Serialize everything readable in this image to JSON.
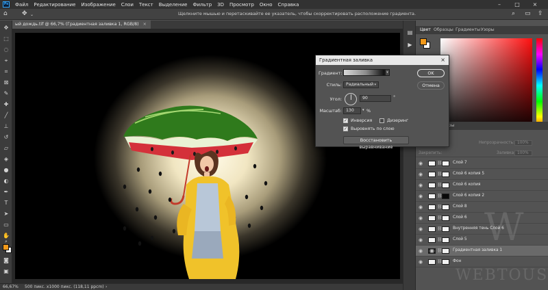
{
  "menu": {
    "logo": "Ps",
    "items": [
      "Файл",
      "Редактирование",
      "Изображение",
      "Слои",
      "Текст",
      "Выделение",
      "Фильтр",
      "3D",
      "Просмотр",
      "Окно",
      "Справка"
    ]
  },
  "options_bar": {
    "hint": "Щелкните мышью и перетаскивайте ее указатель, чтобы скорректировать расположение градиента."
  },
  "document_tab": {
    "title": "ый дождь.tif @ 66,7% (Градиентная заливка 1, RGB/8)",
    "close": "×"
  },
  "status_bar": {
    "zoom": "66,67%",
    "size": "500 пикс. x1000 пикс. (118,11 ppcm)",
    "arrow": "›"
  },
  "color_panel": {
    "tabs": [
      "Цвет",
      "Образцы",
      "Градиенты",
      "Узоры"
    ],
    "foreground": "#f39a1a",
    "background": "#ffffff"
  },
  "layers_panel": {
    "tab": "Контуры",
    "opacity_label": "Непрозрачность:",
    "opacity_value": "100%",
    "lock_label": "Закрепить:",
    "fill_label": "Заливка:",
    "fill_value": "100%",
    "layers": [
      {
        "name": "Слой 7",
        "mask": false,
        "selected": false
      },
      {
        "name": "Слой 6 копия 5",
        "mask": false,
        "selected": false
      },
      {
        "name": "Слой 6 копия",
        "mask": false,
        "selected": false
      },
      {
        "name": "Слой 6 копия 2",
        "mask": true,
        "selected": false
      },
      {
        "name": "Слой 8",
        "mask": false,
        "selected": false
      },
      {
        "name": "Слой 6",
        "mask": false,
        "selected": false
      },
      {
        "name": "Внутренняя тень Слой 6",
        "mask": false,
        "selected": false
      },
      {
        "name": "Слой 5",
        "mask": false,
        "selected": false
      },
      {
        "name": "Градиентная заливка 1",
        "mask": false,
        "selected": true
      },
      {
        "name": "Фон",
        "mask": false,
        "selected": false
      }
    ]
  },
  "watermark": {
    "letter": "W",
    "site": "WEBTOUS.RU"
  },
  "dialog": {
    "title": "Градиентная заливка",
    "close": "×",
    "gradient_label": "Градиент:",
    "style_label": "Стиль:",
    "style_value": "Радиальный",
    "angle_label": "Угол:",
    "angle_value": "90",
    "angle_unit": "°",
    "scale_label": "Масштаб:",
    "scale_value": "130",
    "scale_unit": "%",
    "inverse_label": "Инверсия",
    "dither_label": "Дизеринг",
    "align_label": "Выровнять по слою",
    "reset_button": "Восстановить выравнивание",
    "ok_button": "OK",
    "cancel_button": "Отмена",
    "inverse_checked": true,
    "dither_checked": false,
    "align_checked": true
  }
}
